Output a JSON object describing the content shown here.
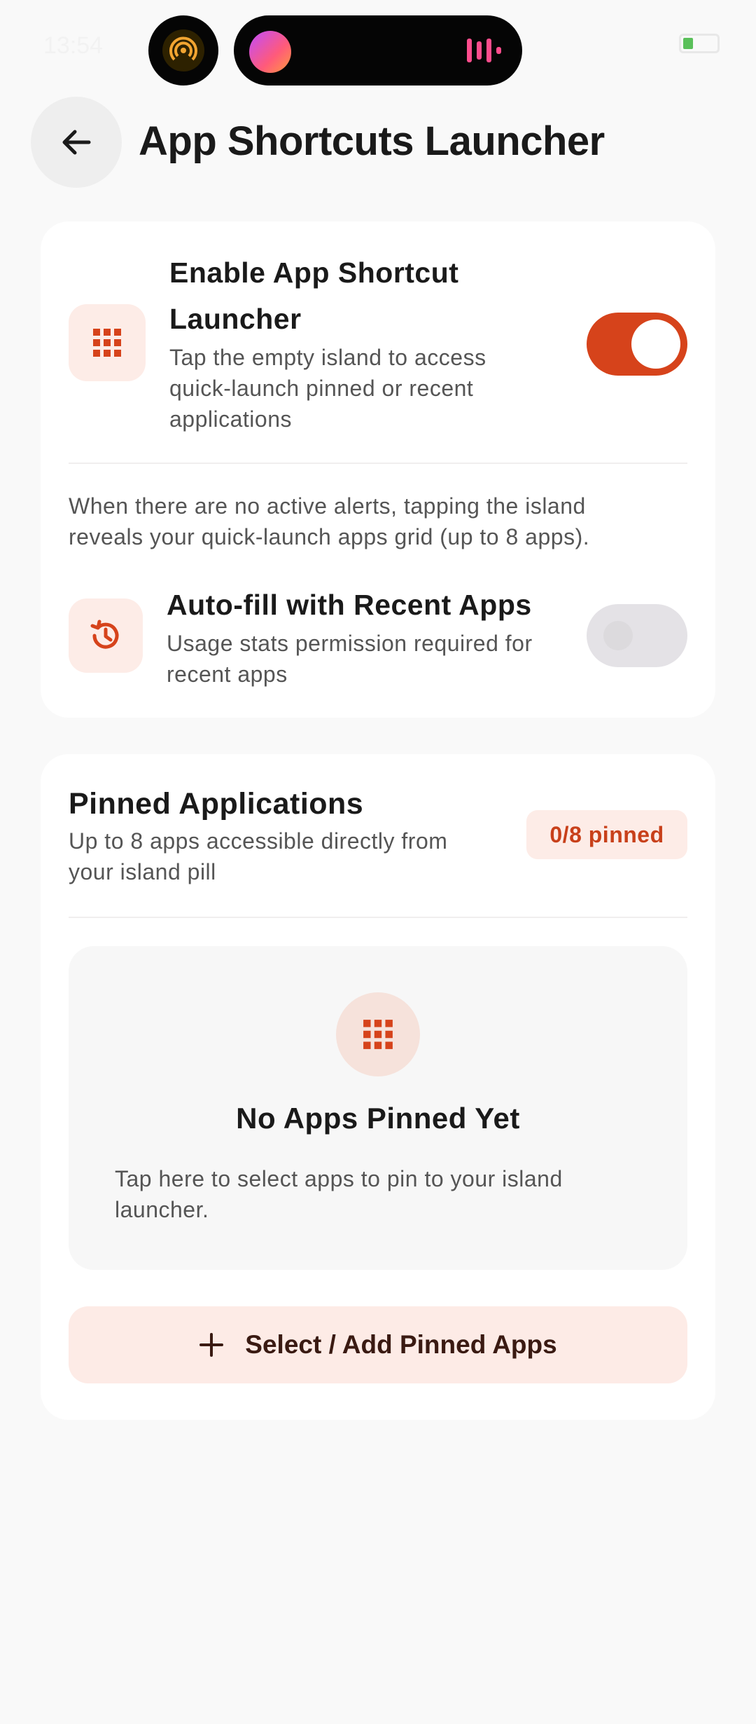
{
  "status_bar": {
    "time": "13:54"
  },
  "header": {
    "title": "App Shortcuts Launcher",
    "back_icon": "arrow-back-icon"
  },
  "launcher_card": {
    "enable": {
      "icon": "apps-grid-icon",
      "title_line1": "Enable App Shortcut",
      "title_line2": "Launcher",
      "desc_line1": "Tap the empty island to access",
      "desc_line2": "quick-launch pinned or recent",
      "desc_line3": "applications",
      "toggle_state": "on"
    },
    "info_line1": "When there are no active alerts, tapping the island",
    "info_line2": "reveals your quick-launch apps grid (up to 8 apps).",
    "autofill": {
      "icon": "history-icon",
      "title": "Auto-fill with Recent Apps",
      "desc_line1": "Usage stats permission required for",
      "desc_line2": "recent apps",
      "toggle_state": "off"
    }
  },
  "pinned_card": {
    "title": "Pinned Applications",
    "desc_line1": "Up to 8 apps accessible directly from",
    "desc_line2": "your island pill",
    "badge": "0/8 pinned",
    "empty": {
      "icon": "apps-grid-icon",
      "title": "No Apps Pinned Yet",
      "desc_line1": "Tap here to select apps to pin to your island",
      "desc_line2": "launcher."
    },
    "add_button": {
      "icon": "plus-icon",
      "label": "Select / Add Pinned Apps"
    }
  },
  "colors": {
    "accent": "#d6431b",
    "accent_soft": "#fdece7",
    "background": "#f9f9f9",
    "card": "#ffffff"
  }
}
